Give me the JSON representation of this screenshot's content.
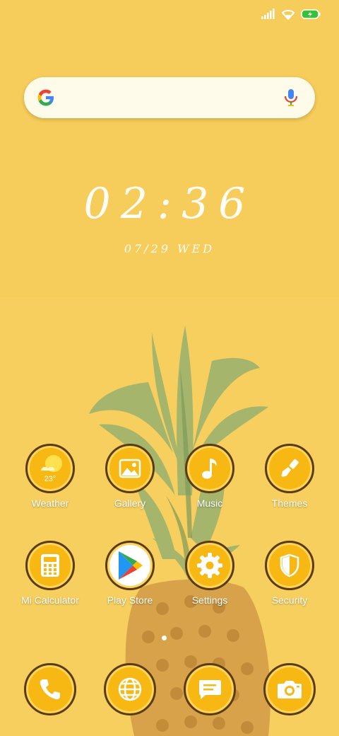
{
  "status_bar": {
    "signal": "signal-icon",
    "wifi": "wifi-icon",
    "battery": "battery-charging-icon"
  },
  "search": {
    "logo": "google-logo",
    "mic": "mic-icon"
  },
  "clock": {
    "time": "02:36",
    "date": "07/29 WED"
  },
  "weather_widget": {
    "temperature": "23°"
  },
  "apps": [
    {
      "label": "Weather",
      "icon": "weather-icon"
    },
    {
      "label": "Gallery",
      "icon": "gallery-icon"
    },
    {
      "label": "Music",
      "icon": "music-note-icon"
    },
    {
      "label": "Themes",
      "icon": "brush-icon"
    },
    {
      "label": "Mi Calculator",
      "icon": "calculator-icon"
    },
    {
      "label": "Play Store",
      "icon": "play-store-icon"
    },
    {
      "label": "Settings",
      "icon": "gear-icon"
    },
    {
      "label": "Security",
      "icon": "shield-icon"
    }
  ],
  "dock": [
    {
      "icon": "phone-icon"
    },
    {
      "icon": "browser-globe-icon"
    },
    {
      "icon": "messaging-icon"
    },
    {
      "icon": "camera-icon"
    }
  ],
  "colors": {
    "background": "#f7cf5e",
    "icon_fill": "#f7b814",
    "icon_border": "#5a3c12"
  }
}
